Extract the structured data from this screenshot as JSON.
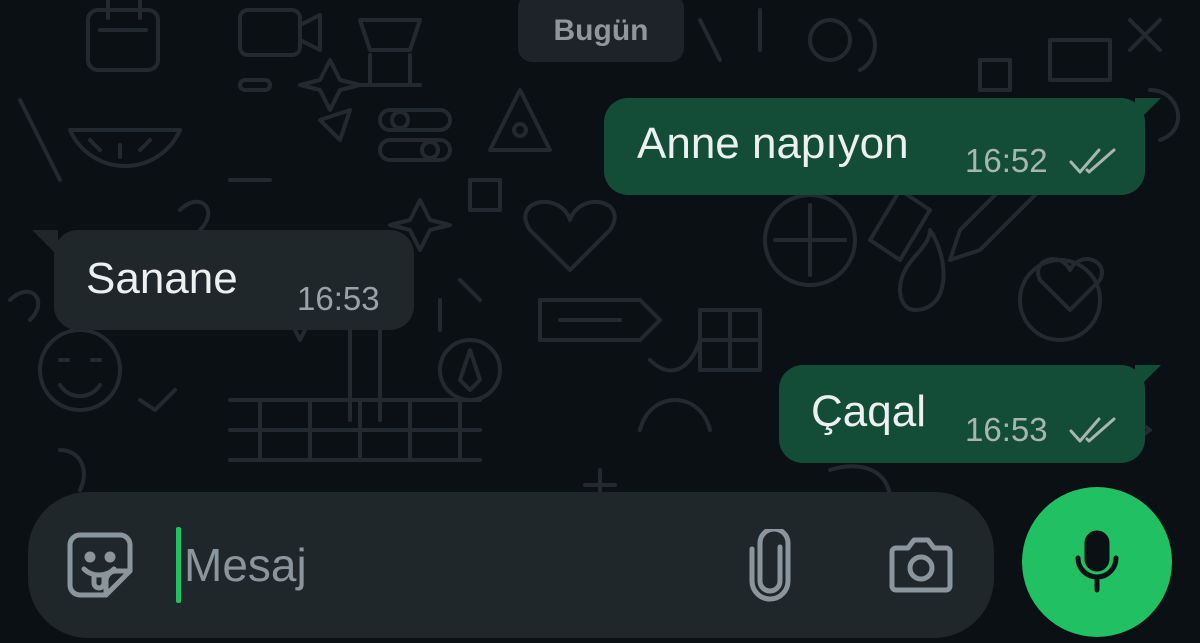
{
  "chat": {
    "date_chip": "Bugün",
    "messages": [
      {
        "direction": "out",
        "text": "Anne napıyon",
        "time": "16:52",
        "status": "read"
      },
      {
        "direction": "in",
        "text": "Sanane",
        "time": "16:53"
      },
      {
        "direction": "out",
        "text": "Çaqal",
        "time": "16:53",
        "status": "read"
      }
    ]
  },
  "composer": {
    "placeholder": "Mesaj",
    "value": "",
    "icons": [
      "sticker-icon",
      "attach-paperclip-icon",
      "camera-icon"
    ],
    "mic_icon": "microphone-icon"
  },
  "colors": {
    "background": "#0b1014",
    "outgoing_bubble": "#144d37",
    "incoming_bubble": "#1f272a",
    "accent": "#21c063",
    "tick": "#a7b7b0"
  }
}
